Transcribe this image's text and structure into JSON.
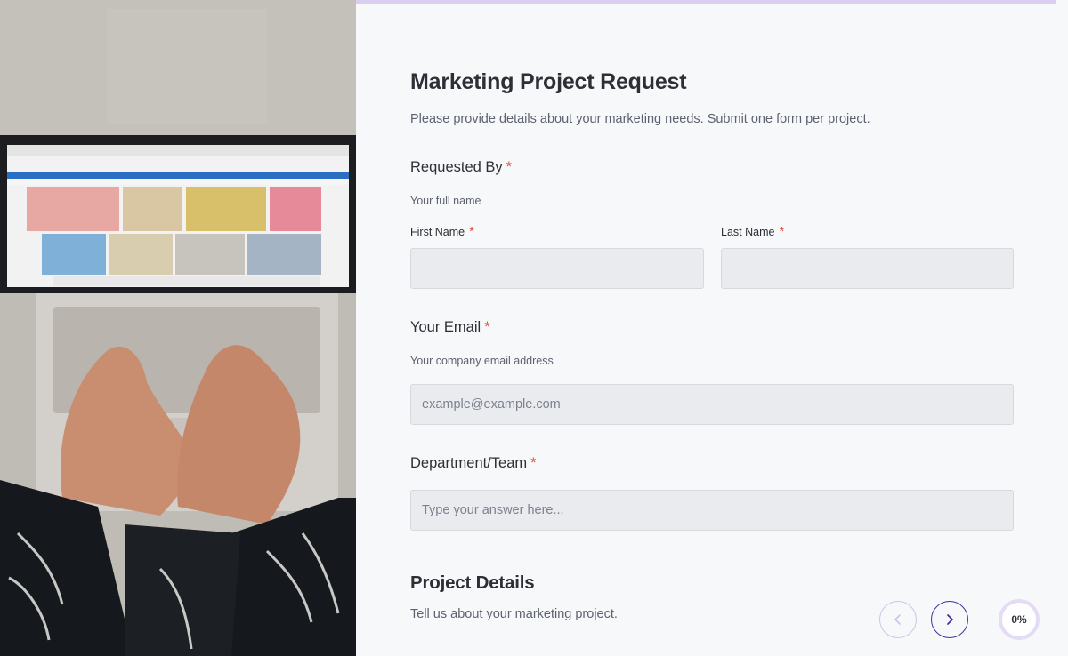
{
  "form": {
    "title": "Marketing Project Request",
    "description": "Please provide details about your marketing needs. Submit one form per project."
  },
  "requested_by": {
    "label": "Requested By",
    "required_mark": "*",
    "sublabel": "Your full name",
    "first_name": {
      "label": "First Name",
      "value": "",
      "required_mark": "*"
    },
    "last_name": {
      "label": "Last Name",
      "value": "",
      "required_mark": "*"
    }
  },
  "email": {
    "label": "Your Email",
    "required_mark": "*",
    "sublabel": "Your company email address",
    "placeholder": "example@example.com",
    "value": ""
  },
  "department": {
    "label": "Department/Team",
    "required_mark": "*",
    "placeholder": "Type your answer here...",
    "value": ""
  },
  "project_details": {
    "title": "Project Details",
    "description": "Tell us about your marketing project."
  },
  "navigation": {
    "prev_icon": "chevron-left-icon",
    "next_icon": "chevron-right-icon",
    "progress_percent": 0,
    "progress_label": "0%"
  },
  "colors": {
    "accent": "#4b2e9e",
    "accent_light": "#cfc3ea",
    "required": "#e0483b",
    "input_bg": "#e9ebee",
    "page_bg": "#f7f8fa"
  }
}
